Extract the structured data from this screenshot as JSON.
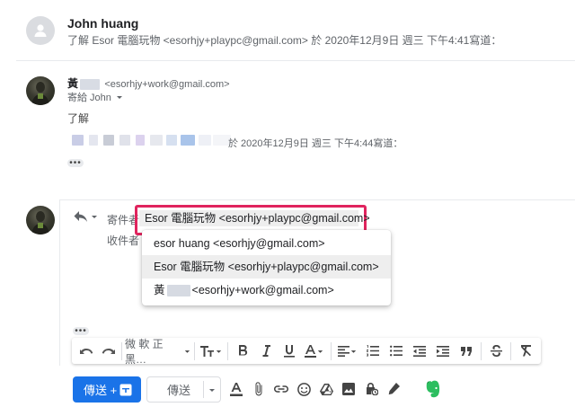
{
  "message1": {
    "sender_name": "John huang",
    "summary": "了解 Esor 電腦玩物 <esorhjy+playpc@gmail.com> 於 2020年12月9日 週三 下午4:41寫道："
  },
  "message2": {
    "sender_name": "黃",
    "sender_email": "<esorhjy+work@gmail.com>",
    "to_label": "寄給 John",
    "body": "了解",
    "quote_header": "於 2020年12月9日 週三 下午4:44寫道："
  },
  "compose": {
    "from_label": "寄件者",
    "to_label": "收件者",
    "from_value": "Esor 電腦玩物 <esorhjy+playpc@gmail.com>",
    "from_options": [
      {
        "label": "esor huang <esorhjy@gmail.com>"
      },
      {
        "label": "Esor 電腦玩物 <esorhjy+playpc@gmail.com>"
      },
      {
        "label": "黃",
        "email": "<esorhjy+work@gmail.com>"
      }
    ],
    "font_name": "微 軟 正 黑…",
    "send_label": "傳送 +",
    "send_secondary_label": "傳送"
  },
  "colors": {
    "highlight": "#e0245e",
    "send_button": "#1a73e8",
    "evernote": "#2dbe60"
  }
}
